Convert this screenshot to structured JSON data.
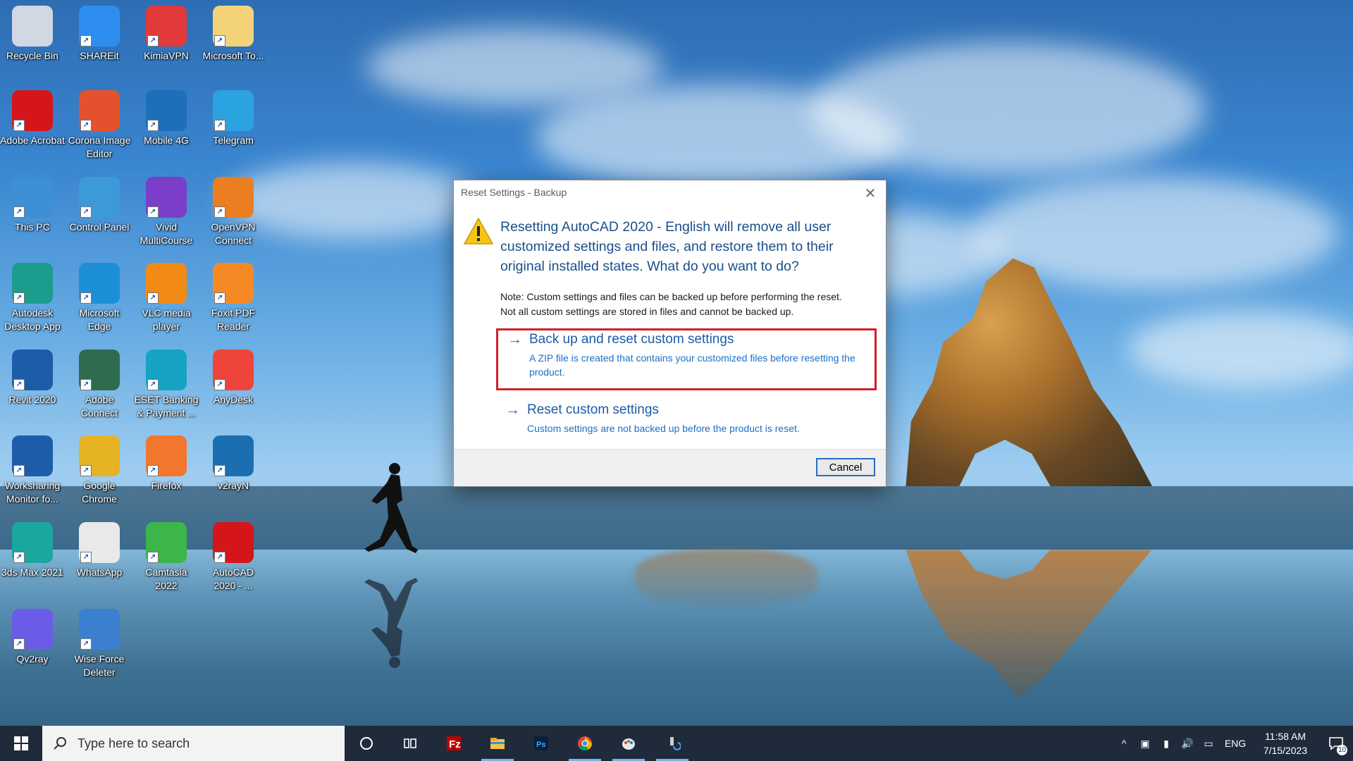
{
  "desktop_icons": [
    {
      "label": "Recycle Bin",
      "icon": "recycle-bin-icon",
      "color": "#cfd8e3"
    },
    {
      "label": "SHAREit",
      "icon": "shareit-icon",
      "color": "#2e8ef0"
    },
    {
      "label": "KimiaVPN",
      "icon": "kimiavpn-icon",
      "color": "#e23a3a"
    },
    {
      "label": "Microsoft To...",
      "icon": "folder-icon",
      "color": "#f3d27a"
    },
    {
      "label": "Adobe Acrobat",
      "icon": "acrobat-icon",
      "color": "#d4161b"
    },
    {
      "label": "Corona Image Editor",
      "icon": "corona-icon",
      "color": "#e4522d"
    },
    {
      "label": "Mobile 4G",
      "icon": "globe-icon",
      "color": "#1c6fb8"
    },
    {
      "label": "Telegram",
      "icon": "telegram-icon",
      "color": "#2aa3e0"
    },
    {
      "label": "This PC",
      "icon": "computer-icon",
      "color": "#3d8fd6"
    },
    {
      "label": "Control Panel",
      "icon": "control-panel-icon",
      "color": "#3c9ad9"
    },
    {
      "label": "Vivid MultiCourse",
      "icon": "vivid-icon",
      "color": "#7a3ec8"
    },
    {
      "label": "OpenVPN Connect",
      "icon": "openvpn-icon",
      "color": "#ea7e20"
    },
    {
      "label": "Autodesk Desktop App",
      "icon": "autodesk-icon",
      "color": "#1c9c8c"
    },
    {
      "label": "Microsoft Edge",
      "icon": "edge-icon",
      "color": "#1c8fd8"
    },
    {
      "label": "VLC media player",
      "icon": "vlc-icon",
      "color": "#f28a16"
    },
    {
      "label": "Foxit PDF Reader",
      "icon": "foxit-icon",
      "color": "#f58a25"
    },
    {
      "label": "Revit 2020",
      "icon": "revit-icon",
      "color": "#1d5ca8"
    },
    {
      "label": "Adobe Connect",
      "icon": "adobe-connect-icon",
      "color": "#2f6b4f"
    },
    {
      "label": "ESET Banking & Payment ...",
      "icon": "eset-icon",
      "color": "#16a3c4"
    },
    {
      "label": "AnyDesk",
      "icon": "anydesk-icon",
      "color": "#ef443b"
    },
    {
      "label": "Worksharing Monitor fo...",
      "icon": "worksharing-icon",
      "color": "#1d5ca8"
    },
    {
      "label": "Google Chrome",
      "icon": "chrome-icon",
      "color": "#e6b325"
    },
    {
      "label": "Firefox",
      "icon": "firefox-icon",
      "color": "#f2762e"
    },
    {
      "label": "v2rayN",
      "icon": "v2rayn-icon",
      "color": "#1b6fb0"
    },
    {
      "label": "3ds Max 2021",
      "icon": "3dsmax-icon",
      "color": "#1aa7a0"
    },
    {
      "label": "WhatsApp",
      "icon": "whatsapp-icon",
      "color": "#e9e9e9"
    },
    {
      "label": "Camtasia 2022",
      "icon": "camtasia-icon",
      "color": "#3cb54a"
    },
    {
      "label": "AutoCAD 2020 - ...",
      "icon": "autocad-icon",
      "color": "#d4161b"
    },
    {
      "label": "Qv2ray",
      "icon": "qv2ray-icon",
      "color": "#6b5ce8"
    },
    {
      "label": "Wise Force Deleter",
      "icon": "wise-force-deleter-icon",
      "color": "#3a7fd0"
    }
  ],
  "dialog": {
    "title": "Reset Settings - Backup",
    "close_glyph": "✕",
    "message": "Resetting AutoCAD 2020 - English will remove all user customized settings and files, and restore them to their original installed states. What do you want to do?",
    "note_line1": "Note: Custom settings and files can be backed up before performing the reset.",
    "note_line2": "Not all custom settings are stored in files and cannot be backed up.",
    "option1": {
      "arrow": "→",
      "title": "Back up and reset custom settings",
      "description": "A ZIP file is created that contains your customized files before resetting the product."
    },
    "option2": {
      "arrow": "→",
      "title": "Reset custom settings",
      "description": "Custom settings are not backed up before the product is reset."
    },
    "cancel_label": "Cancel"
  },
  "taskbar": {
    "search_placeholder": "Type here to search",
    "pinned": [
      {
        "icon": "cortana-icon",
        "open": false
      },
      {
        "icon": "task-view-icon",
        "open": false
      },
      {
        "icon": "filezilla-icon",
        "open": false
      },
      {
        "icon": "file-explorer-icon",
        "open": true
      },
      {
        "icon": "photoshop-icon",
        "open": false
      },
      {
        "icon": "chrome-icon",
        "open": true
      },
      {
        "icon": "paint-icon",
        "open": true
      },
      {
        "icon": "autocad-reset-tool-icon",
        "open": true
      }
    ],
    "language": "ENG",
    "time": "11:58 AM",
    "date": "7/15/2023",
    "notification_count": "10"
  },
  "colors": {
    "taskbar_bg": "#1f2b3b",
    "dialog_heading": "#1a4f8b",
    "link_blue": "#1a6fc7",
    "highlight_red": "#d1202c"
  }
}
